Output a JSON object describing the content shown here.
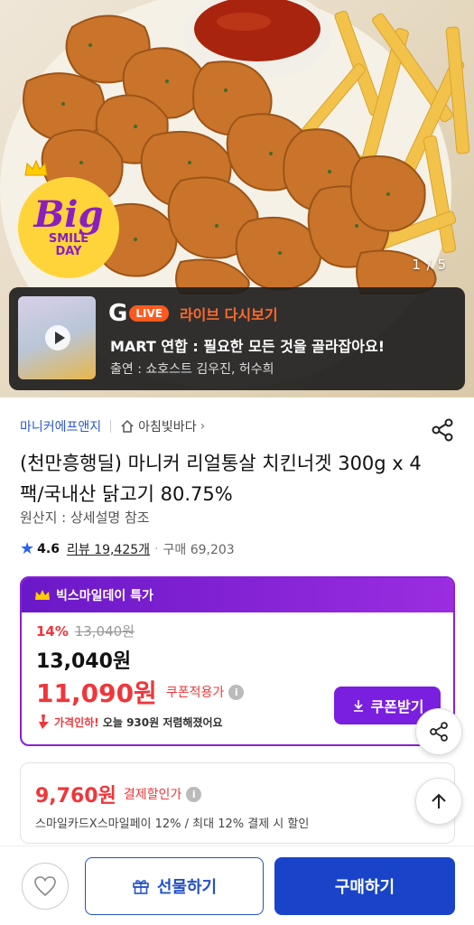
{
  "hero": {
    "counter": "1 / 5",
    "badge": {
      "big": "Big",
      "sub": "SMILE DAY"
    },
    "live": {
      "g_letter": "G",
      "live_label": "LIVE",
      "replay_label": "라이브 다시보기",
      "title": "MART 연합 : 필요한 모든 것을 골라잡아요!",
      "cast": "출연 : 쇼호스트 김우진, 허수희"
    }
  },
  "product": {
    "seller": "마니커에프앤지",
    "store": "아침빛바다",
    "title": "(천만흥행딜) 마니커 리얼통살 치킨너겟 300g x 4팩/국내산 닭고기 80.75%",
    "origin": "원산지 : 상세설명 참조",
    "rating": "4.6",
    "reviews": "리뷰 19,425개",
    "purchases": "구매 69,203"
  },
  "deal": {
    "header": "빅스마일데이 특가",
    "discount": "14%",
    "original_price": "13,040원",
    "price": "13,040원",
    "coupon_price": "11,090원",
    "coupon_label": "쿠폰적용가",
    "price_drop_prefix": "가격인하!",
    "price_drop_text": "오늘 930원 저렴해졌어요",
    "coupon_button": "쿠폰받기"
  },
  "payment": {
    "price": "9,760원",
    "label": "결제할인가",
    "desc": "스마일카드X스마일페이 12% / 최대 12% 결제 시 할인"
  },
  "bottom": {
    "gift": "선물하기",
    "buy": "구매하기"
  },
  "colors": {
    "accent_blue": "#1944c9",
    "deal_purple": "#8a1fd8",
    "price_red": "#f0363a",
    "live_orange": "#ff5a1e"
  }
}
